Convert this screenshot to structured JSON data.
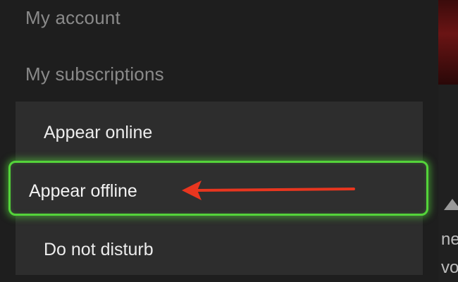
{
  "menu": {
    "my_account": "My account",
    "my_subscriptions": "My subscriptions"
  },
  "status_options": [
    {
      "label": "Appear online"
    },
    {
      "label": "Appear offline",
      "focused": true
    },
    {
      "label": "Do not disturb"
    }
  ],
  "background_text": {
    "line1": "ne",
    "line2": "vo"
  },
  "colors": {
    "focus_glow": "#54d43a",
    "annotation_arrow": "#e8361f"
  },
  "annotation": {
    "icon": "red-arrow-pointing-left"
  }
}
